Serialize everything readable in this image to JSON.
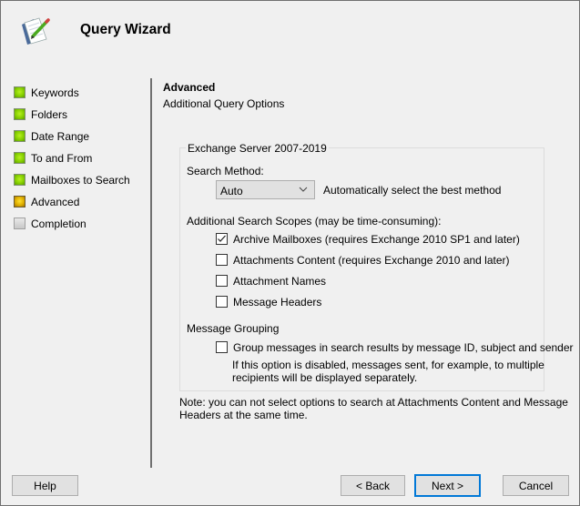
{
  "window": {
    "title": "Query Wizard"
  },
  "steps": [
    {
      "label": "Keywords",
      "status": "done"
    },
    {
      "label": "Folders",
      "status": "done"
    },
    {
      "label": "Date Range",
      "status": "done"
    },
    {
      "label": "To and From",
      "status": "done"
    },
    {
      "label": "Mailboxes to Search",
      "status": "done"
    },
    {
      "label": "Advanced",
      "status": "current"
    },
    {
      "label": "Completion",
      "status": "pending"
    }
  ],
  "section": {
    "title": "Advanced",
    "subtitle": "Additional Query Options"
  },
  "group": {
    "legend": "Exchange Server 2007-2019",
    "search_method_label": "Search Method:",
    "search_method_value": "Auto",
    "search_method_hint": "Automatically select the best method",
    "scopes_label": "Additional Search Scopes (may be time-consuming):",
    "scopes": [
      {
        "label": "Archive Mailboxes (requires Exchange 2010 SP1 and later)",
        "checked": true
      },
      {
        "label": "Attachments Content (requires Exchange 2010 and later)",
        "checked": false
      },
      {
        "label": "Attachment Names",
        "checked": false
      },
      {
        "label": "Message Headers",
        "checked": false
      }
    ],
    "grouping_label": "Message Grouping",
    "grouping_option": {
      "label": "Group messages in search results by message ID, subject and sender",
      "checked": false
    },
    "grouping_hint_1": "If this option is disabled, messages sent, for example, to multiple",
    "grouping_hint_2": "recipients will be displayed separately."
  },
  "note_1": "Note: you can not select options to search at Attachments Content and Message",
  "note_2": "Headers at the same time.",
  "buttons": {
    "help": "Help",
    "back": "< Back",
    "next": "Next >",
    "cancel": "Cancel"
  },
  "colors": {
    "accent": "#0078d7",
    "done": "#86d000",
    "current": "#e0b000",
    "pending": "#c8c8c8"
  }
}
